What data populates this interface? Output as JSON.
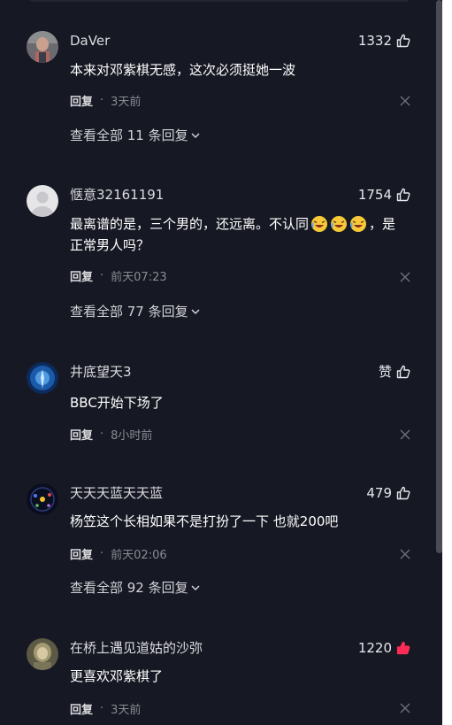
{
  "reply_label": "回复",
  "comments": [
    {
      "username": "DaVer",
      "likes": "1332",
      "text": "本来对邓紫棋无感，这次必须挺她一波",
      "time": "3天前",
      "view_all": "查看全部 11 条回复",
      "liked": false
    },
    {
      "username": "惬意32161191",
      "likes": "1754",
      "text_line1_a": "最离谱的是，三个男的，还远离。不认同",
      "text_line1_b": "，是",
      "text_line2": "正常男人吗？",
      "emojis": [
        "laughing-crying-emoji",
        "laughing-crying-emoji",
        "laughing-crying-emoji"
      ],
      "time": "前天07:23",
      "view_all": "查看全部 77 条回复",
      "liked": false
    },
    {
      "username": "井底望天3",
      "likes": "赞",
      "text": "BBC开始下场了",
      "time": "8小时前",
      "liked": false
    },
    {
      "username": "天天天蓝天天蓝",
      "likes": "479",
      "text": "杨笠这个长相如果不是打扮了一下 也就200吧",
      "time": "前天02:06",
      "view_all": "查看全部 92 条回复",
      "liked": false
    },
    {
      "username": "在桥上遇见道姑的沙弥",
      "likes": "1220",
      "text": "更喜欢邓紫棋了",
      "time": "3天前",
      "liked": true
    }
  ],
  "colors": {
    "background": "#161823",
    "liked": "#fe2c55"
  }
}
